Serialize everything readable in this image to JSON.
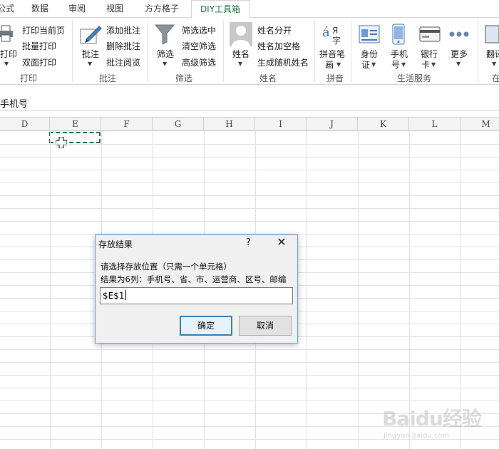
{
  "tabs": [
    "公式",
    "数据",
    "审阅",
    "视图",
    "方方格子",
    "DIY工具箱"
  ],
  "active_tab": "DIY工具箱",
  "ribbon": {
    "print": {
      "big_label": "打印",
      "items": [
        "打印当前页",
        "批量打印",
        "双面打印"
      ],
      "group_label": "打印"
    },
    "comment": {
      "big_label": "批注",
      "items": [
        "添加批注",
        "删除批注",
        "批注阅览"
      ],
      "group_label": "批注"
    },
    "filter": {
      "big_label": "筛选",
      "items": [
        "筛选选中",
        "清空筛选",
        "高级筛选"
      ],
      "group_label": "筛选"
    },
    "name": {
      "big_label": "姓名",
      "items": [
        "姓名分开",
        "姓名加空格",
        "生成随机姓名"
      ],
      "group_label": "姓名"
    },
    "pinyin": {
      "big_label_line1": "拼音笔",
      "big_label_line2": "画",
      "group_label": "拼音"
    },
    "life": {
      "idcard_line1": "身份",
      "idcard_line2": "证",
      "phone_line1": "手机",
      "phone_line2": "号",
      "bank_line1": "银行",
      "bank_line2": "卡",
      "more": "更多",
      "group_label": "生活服务"
    },
    "translate": {
      "label": "翻译",
      "group_label": "在"
    }
  },
  "name_bar_text": "手机号",
  "columns": [
    "D",
    "E",
    "F",
    "G",
    "H",
    "I",
    "J",
    "K",
    "L",
    "M"
  ],
  "selected_cell": "E1",
  "dialog": {
    "title": "存放结果",
    "help": "?",
    "close": "✕",
    "line1": "请选择存放位置（只需一个单元格）",
    "line2": "结果为6列：手机号、省、市、运营商、区号、邮编",
    "input_value": "$E$1",
    "ok_label": "确定",
    "cancel_label": "取消"
  },
  "watermark": {
    "brand": "Baidu经验",
    "url": "jingyan.baidu.com"
  }
}
